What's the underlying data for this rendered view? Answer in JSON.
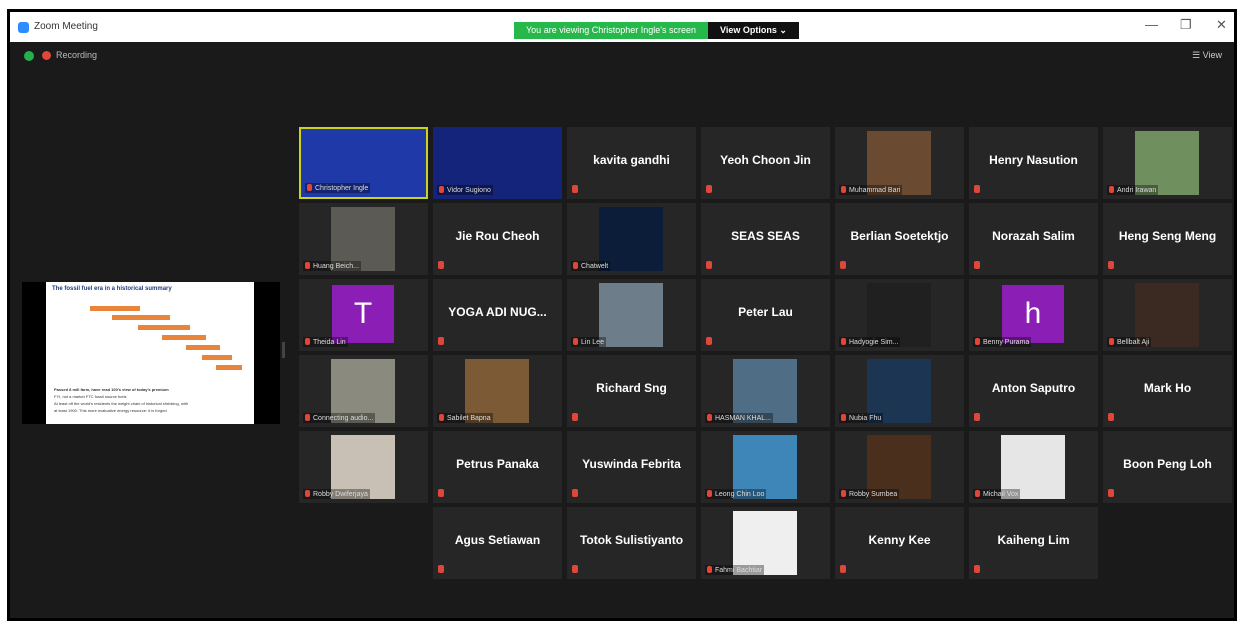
{
  "window": {
    "title": "Zoom Meeting"
  },
  "share_banner": {
    "viewing_text": "You are viewing Christopher Ingle's screen",
    "view_options_label": "View Options ⌄"
  },
  "window_controls": {
    "minimize": "—",
    "maximize": "❐",
    "close": "✕"
  },
  "toolbar": {
    "recording_label": "Recording",
    "view_label": "☰ View"
  },
  "shared_slide": {
    "title": "The fossil fuel era in a historical summary",
    "footer_1": "Passed 8 mill farm, have read 100's view of today's premium",
    "footer_2": "FYI, not a market FTC fossil source fuels",
    "footer_3": "At least off the world's residents the weight chain of historical shrinking, with",
    "footer_4": "at least 1900. This more evaluative energy resource: it is forged"
  },
  "tiles": [
    {
      "type": "video",
      "label": "Christopher Ingle",
      "active": true,
      "bg": "#1f3aa8"
    },
    {
      "type": "screen",
      "label": "Vidor Sugiono"
    },
    {
      "type": "name",
      "name": "kavita gandhi"
    },
    {
      "type": "name",
      "name": "Yeoh Choon Jin"
    },
    {
      "type": "video",
      "label": "Muhammad Bari",
      "bg": "#6b4a32"
    },
    {
      "type": "name",
      "name": "Henry Nasution"
    },
    {
      "type": "video",
      "label": "Andri Irawan",
      "bg": "#6f8f5e"
    },
    {
      "type": "video",
      "label": "Huang Beich...",
      "bg": "#5b5a54"
    },
    {
      "type": "name",
      "name": "Jie Rou Cheoh"
    },
    {
      "type": "video",
      "label": "Chatwelt",
      "bg": "#0c1d3a"
    },
    {
      "type": "name",
      "name": "SEAS SEAS"
    },
    {
      "type": "name",
      "name": "Berlian Soetektjo"
    },
    {
      "type": "name",
      "name": "Norazah Salim"
    },
    {
      "type": "name",
      "name": "Heng Seng Meng"
    },
    {
      "type": "letter",
      "letter": "T",
      "label": "Theida Lin"
    },
    {
      "type": "name",
      "name": "YOGA ADI NUG..."
    },
    {
      "type": "video",
      "label": "Lin Lee",
      "bg": "#6d7d8a"
    },
    {
      "type": "name",
      "name": "Peter Lau"
    },
    {
      "type": "video",
      "label": "Hadyogie Sim...",
      "bg": "#202020"
    },
    {
      "type": "letter",
      "letter": "h",
      "label": "Benny Purama"
    },
    {
      "type": "video",
      "label": "Bellbalt Aji",
      "bg": "#3a2a22"
    },
    {
      "type": "video",
      "label": "Connecting audio...",
      "bg": "#8a8a7e"
    },
    {
      "type": "video",
      "label": "Sabilet Bapna",
      "bg": "#7c5a36"
    },
    {
      "type": "name",
      "name": "Richard Sng"
    },
    {
      "type": "video",
      "label": "HASMAN KHAL...",
      "bg": "#4f6d85"
    },
    {
      "type": "video",
      "label": "Nubia Fhu",
      "bg": "#1b3552"
    },
    {
      "type": "name",
      "name": "Anton Saputro"
    },
    {
      "type": "name",
      "name": "Mark Ho"
    },
    {
      "type": "video",
      "label": "Robby Dwiferjaya",
      "bg": "#c8c0b4"
    },
    {
      "type": "name",
      "name": "Petrus Panaka"
    },
    {
      "type": "name",
      "name": "Yuswinda Febrita"
    },
    {
      "type": "video",
      "label": "Leong Chin Loo",
      "bg": "#3f86b8"
    },
    {
      "type": "video",
      "label": "Robby Sumbea",
      "bg": "#4a2f1c"
    },
    {
      "type": "video",
      "label": "Michail Vox",
      "bg": "#e6e6e6"
    },
    {
      "type": "name",
      "name": "Boon Peng Loh"
    },
    {
      "type": "empty"
    },
    {
      "type": "name",
      "name": "Agus Setiawan"
    },
    {
      "type": "name",
      "name": "Totok Sulistiyanto"
    },
    {
      "type": "video",
      "label": "Fahmi Bachtiar",
      "bg": "#efefef"
    },
    {
      "type": "name",
      "name": "Kenny Kee"
    },
    {
      "type": "name",
      "name": "Kaiheng Lim"
    },
    {
      "type": "empty"
    }
  ]
}
